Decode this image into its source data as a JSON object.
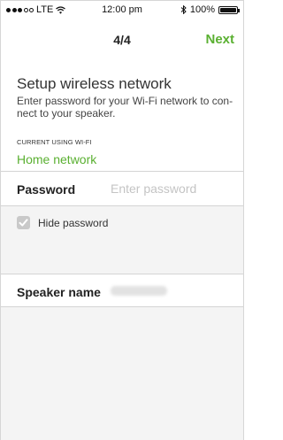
{
  "status_bar": {
    "signal_dots_filled": 3,
    "signal_dots_total": 5,
    "carrier": "LTE",
    "time": "12:00 pm",
    "battery": "100%",
    "battery_level": 1.0
  },
  "nav": {
    "title": "4/4",
    "next_label": "Next"
  },
  "setup": {
    "title": "Setup wireless network",
    "description": "Enter password for your Wi-Fi network to con-nect to your speaker.",
    "current_label": "CURRENT USING WI-FI",
    "current_network": "Home network"
  },
  "password": {
    "label": "Password",
    "placeholder": "Enter password",
    "value": ""
  },
  "hide_password": {
    "label": "Hide password",
    "checked": true
  },
  "speaker": {
    "label": "Speaker name"
  },
  "colors": {
    "accent": "#5ab031",
    "section_bg": "#f4f4f4",
    "divider": "#d4d4d4"
  }
}
